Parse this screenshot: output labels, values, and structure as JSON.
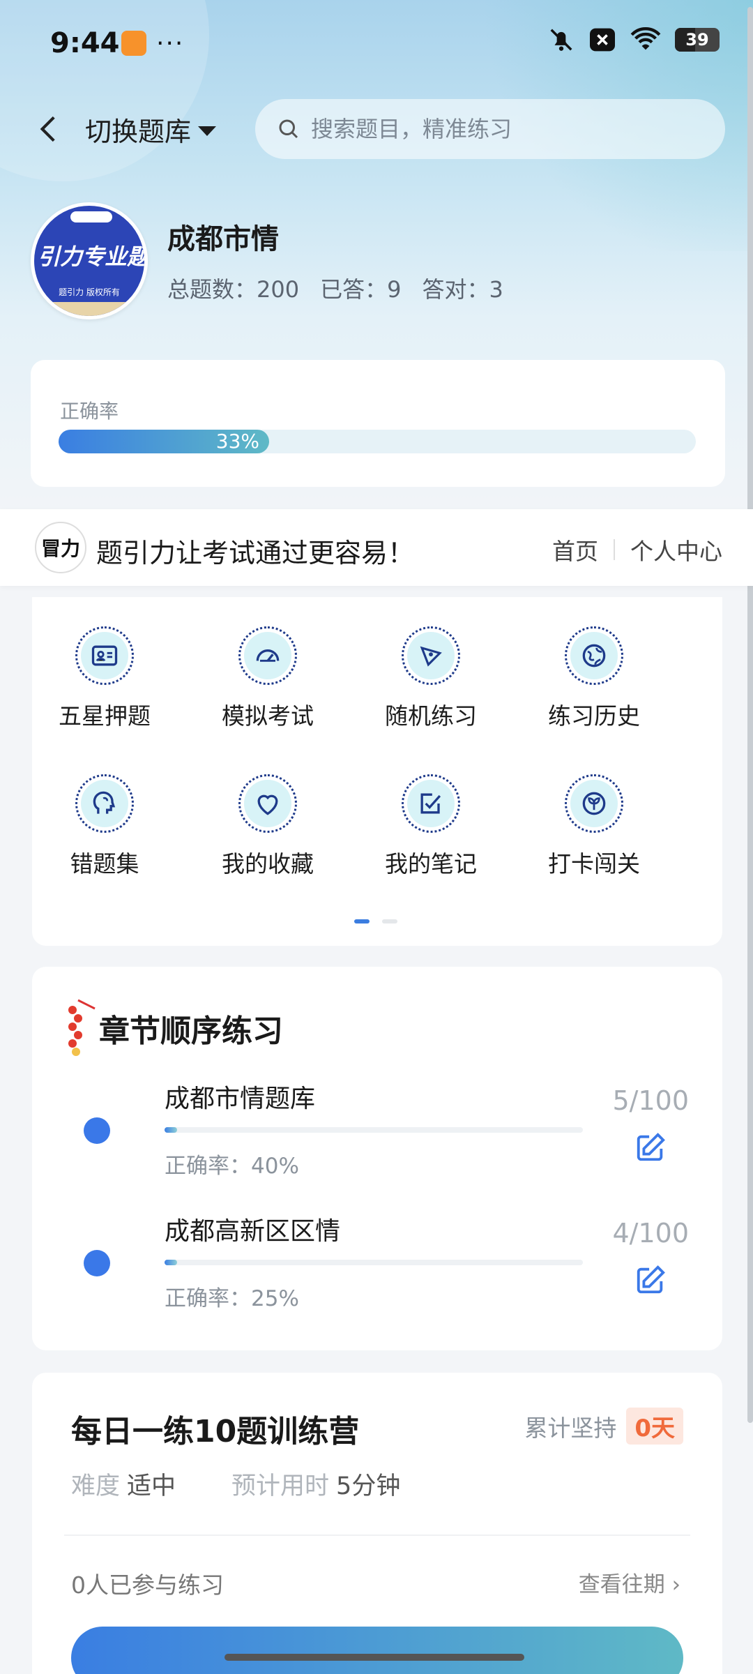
{
  "status": {
    "time": "9:44",
    "more": "···",
    "battery": "39"
  },
  "nav": {
    "switch_label": "切换题库",
    "search_placeholder": "搜索题目，精准练习"
  },
  "bank": {
    "logo_text": "引力专业题",
    "logo_sub": "题引力 版权所有",
    "name": "成都市情",
    "stats": {
      "total": "总题数：200",
      "answered": "已答：9",
      "correct": "答对：3"
    }
  },
  "accuracy": {
    "label": "正确率",
    "percent_text": "33%",
    "fraction": 0.33
  },
  "banner": {
    "logo_text": "冒力",
    "text": "题引力让考试通过更容易！",
    "home": "首页",
    "profile": "个人中心"
  },
  "features": [
    {
      "label": "五星押题",
      "icon": "id-card-icon"
    },
    {
      "label": "模拟考试",
      "icon": "gauge-icon"
    },
    {
      "label": "随机练习",
      "icon": "network-icon"
    },
    {
      "label": "练习历史",
      "icon": "globe-icon"
    },
    {
      "label": "错题集",
      "icon": "head-icon"
    },
    {
      "label": "我的收藏",
      "icon": "heart-icon"
    },
    {
      "label": "我的笔记",
      "icon": "note-check-icon"
    },
    {
      "label": "打卡闯关",
      "icon": "leaf-icon"
    }
  ],
  "chapters": {
    "title": "章节顺序练习",
    "items": [
      {
        "name": "成都市情题库",
        "accuracy": "正确率：40%",
        "count": "5/100",
        "progress": 0.05
      },
      {
        "name": "成都高新区区情",
        "accuracy": "正确率：25%",
        "count": "4/100",
        "progress": 0.04
      }
    ]
  },
  "daily": {
    "title": "每日一练10题训练营",
    "streak_label": "累计坚持",
    "streak_value": "0天",
    "difficulty_label": "难度",
    "difficulty_value": "适中",
    "time_label": "预计用时",
    "time_value": "5分钟",
    "participants": "0人已参与练习",
    "past": "查看往期"
  },
  "colors": {
    "accent": "#3a78e8",
    "teal": "#5fb9c6",
    "streak": "#f06a3b"
  }
}
